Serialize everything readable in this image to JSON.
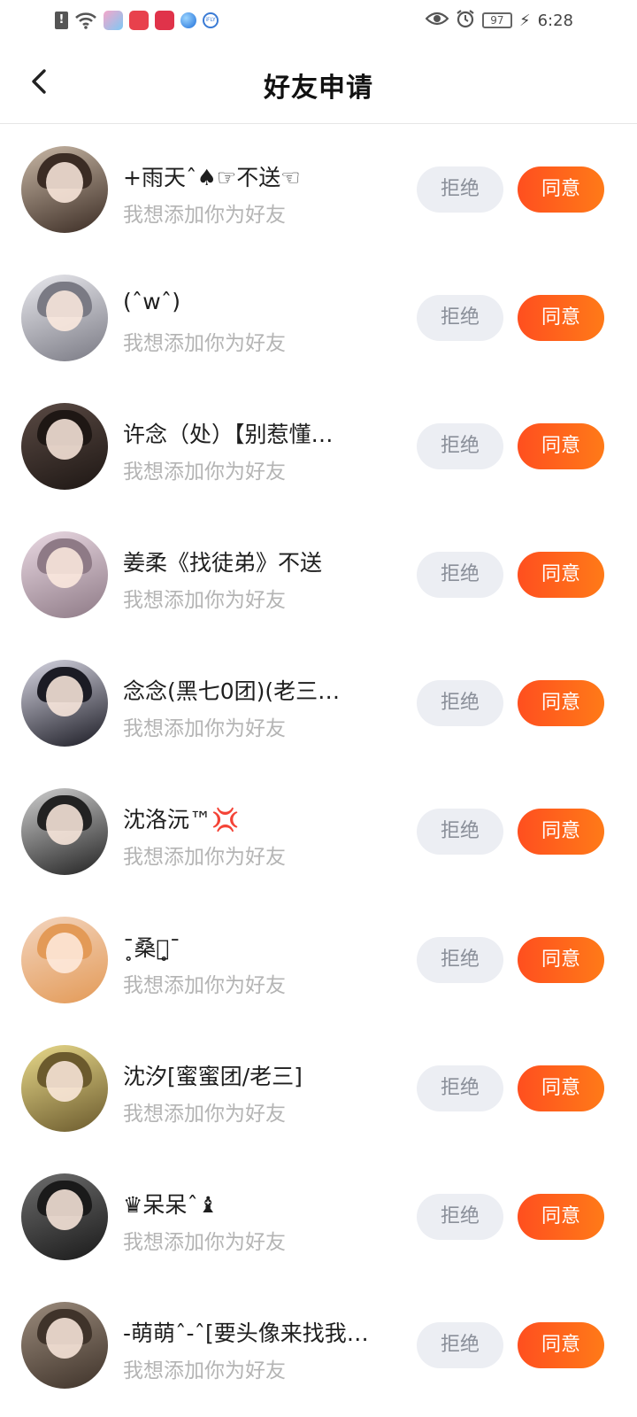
{
  "status_bar": {
    "sim_icon": "sim-alert-icon",
    "time": "6:28",
    "battery": "97",
    "app_icons": [
      "game-app-icon",
      "shop-app-icon",
      "reader-app-icon",
      "browser-app-icon",
      "ifly-app-icon"
    ],
    "ifly_label": "iFLY"
  },
  "header": {
    "title": "好友申请",
    "back_icon": "chevron-left-icon"
  },
  "requests": [
    {
      "name": "+雨天ˆ♠☞不送☜",
      "message": "我想添加你为好友",
      "reject_label": "拒绝",
      "accept_label": "同意",
      "avatar_colors": [
        "#c9b8a6",
        "#3b2c24"
      ]
    },
    {
      "name": "(ˆwˆ)",
      "message": "我想添加你为好友",
      "reject_label": "拒绝",
      "accept_label": "同意",
      "avatar_colors": [
        "#e9e9ee",
        "#7a7a84"
      ]
    },
    {
      "name": "许念（处）【别惹懂…",
      "message": "我想添加你为好友",
      "reject_label": "拒绝",
      "accept_label": "同意",
      "avatar_colors": [
        "#5a4a44",
        "#1e1714"
      ]
    },
    {
      "name": "姜柔《找徒弟》不送",
      "message": "我想添加你为好友",
      "reject_label": "拒绝",
      "accept_label": "同意",
      "avatar_colors": [
        "#ead9e3",
        "#8e7a86"
      ]
    },
    {
      "name": "念念(黑七0团)(老三…",
      "message": "我想添加你为好友",
      "reject_label": "拒绝",
      "accept_label": "同意",
      "avatar_colors": [
        "#d7d6e3",
        "#1b1b24"
      ]
    },
    {
      "name": "沈洛沅™💢",
      "message": "我想添加你为好友",
      "reject_label": "拒绝",
      "accept_label": "同意",
      "avatar_colors": [
        "#cfcfcf",
        "#222222"
      ]
    },
    {
      "name": "¯̥桑稚̥¯",
      "message": "我想添加你为好友",
      "reject_label": "拒绝",
      "accept_label": "同意",
      "avatar_colors": [
        "#f3d5bf",
        "#e39a57"
      ]
    },
    {
      "name": "沈汐[蜜蜜团/老三]",
      "message": "我想添加你为好友",
      "reject_label": "拒绝",
      "accept_label": "同意",
      "avatar_colors": [
        "#e8d98a",
        "#6b5a2d"
      ]
    },
    {
      "name": "♛呆呆ˆ♝",
      "message": "我想添加你为好友",
      "reject_label": "拒绝",
      "accept_label": "同意",
      "avatar_colors": [
        "#6d6d6d",
        "#1a1a1a"
      ]
    },
    {
      "name": "-萌萌ˆ-ˆ[要头像来找我…",
      "message": "我想添加你为好友",
      "reject_label": "拒绝",
      "accept_label": "同意",
      "avatar_colors": [
        "#9b8b7c",
        "#3f332a"
      ]
    }
  ]
}
